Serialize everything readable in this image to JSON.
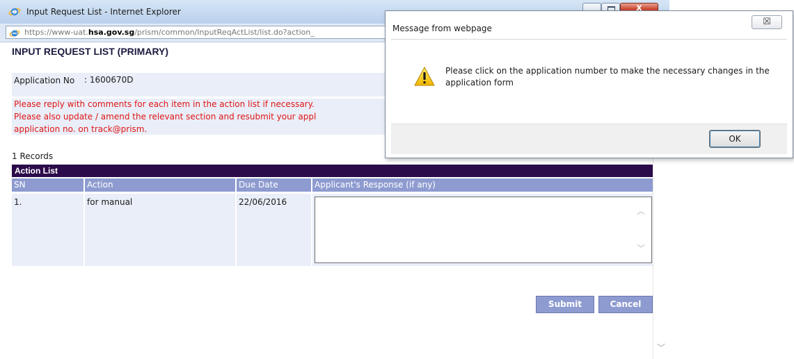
{
  "window": {
    "title": "Input Request List - Internet Explorer",
    "close_label": "x"
  },
  "address": {
    "url_prefix": "https://www-uat.",
    "url_domain": "hsa.gov.sg",
    "url_rest": "/prism/common/InputReqActList/list.do?action_"
  },
  "page": {
    "title": "INPUT REQUEST LIST (PRIMARY)",
    "application_no_label": "Application No",
    "application_no_value": ": 1600670D",
    "instructions": [
      "Please reply with comments for each item in the action list if necessary.",
      "Please also update / amend the relevant section and resubmit your appl",
      "application no. on track@prism."
    ],
    "records_count": "1 Records",
    "action_list_title": "Action List",
    "columns": [
      "SN",
      "Action",
      "Due Date",
      "Applicant's Response (if any)"
    ],
    "rows": [
      {
        "sn": "1.",
        "action": "for manual",
        "due_date": "22/06/2016",
        "response": ""
      }
    ],
    "submit_label": "Submit",
    "cancel_label": "Cancel"
  },
  "dialog": {
    "title": "Message from webpage",
    "close_glyph": "☒",
    "message": "Please click on the application number to make the necessary changes in the application form",
    "ok_label": "OK"
  },
  "icons": {
    "ie": "ie-logo-icon",
    "warning": "warning-icon",
    "scroll_up": "chevron-up-icon",
    "scroll_down": "chevron-down-icon"
  },
  "colors": {
    "accent_header": "#2c0b4a",
    "column_header": "#8e9bd0",
    "row_background": "#e9eef8",
    "instruction_text": "#e01515"
  }
}
